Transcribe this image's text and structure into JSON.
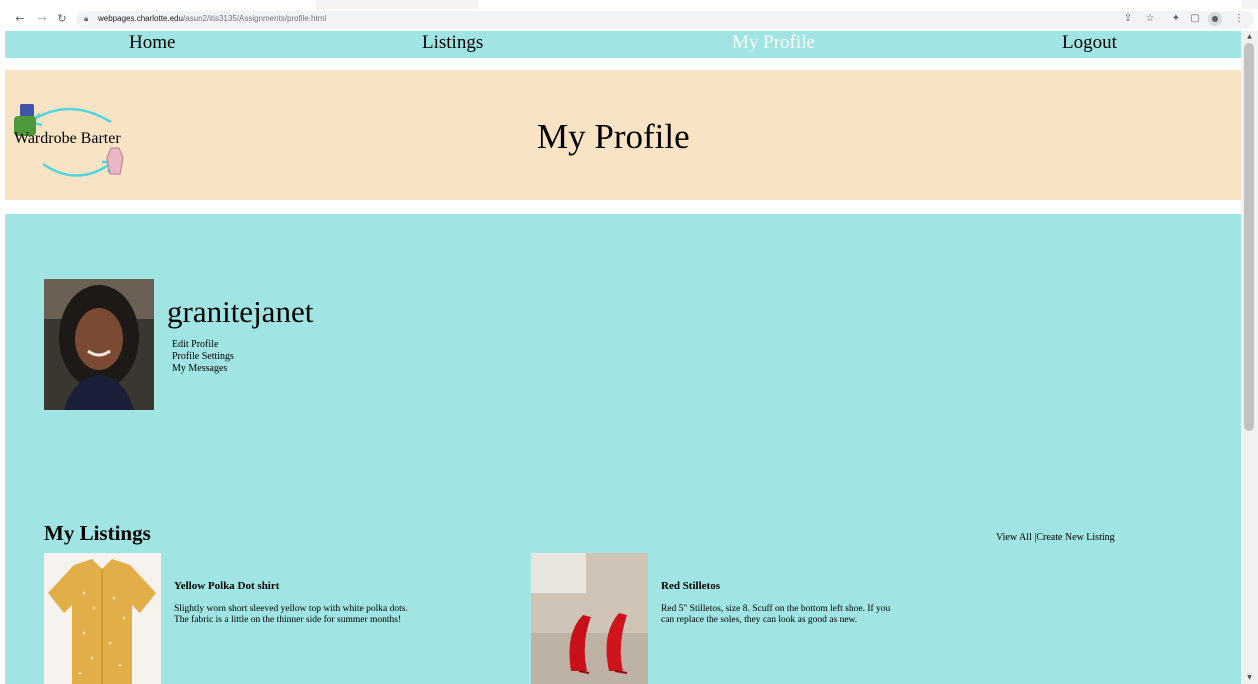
{
  "browser": {
    "url_host": "webpages.charlotte.edu",
    "url_path": "/asun2/itis3135/Assignments/profile.html",
    "icons": [
      "back-icon",
      "forward-icon",
      "reload-icon",
      "lock-icon",
      "share-icon",
      "star-icon",
      "extensions-icon",
      "sidepanel-icon",
      "profile-icon",
      "menu-icon"
    ]
  },
  "nav": {
    "items": [
      "Home",
      "Listings",
      "My Profile",
      "Logout"
    ],
    "active": "My Profile"
  },
  "banner": {
    "logo_text": "Wardrobe Barter",
    "title": "My Profile"
  },
  "profile": {
    "username": "granitejanet",
    "links": [
      "Edit Profile",
      "Profile Settings",
      "My Messages"
    ]
  },
  "listings": {
    "heading": "My Listings",
    "view_all": "View All",
    "separator": " |",
    "create_new": "Create New Listing",
    "items": [
      {
        "title": "Yellow Polka Dot shirt",
        "description": "Slightly worn short sleeved yellow top with white polka dots. The fabric is a little on the thinner side for summer months!"
      },
      {
        "title": "Red Stilletos",
        "description": "Red 5\" Stilletos, size 8. Scuff on the bottom left shoe. If you can replace the soles, they can look as good as new."
      }
    ]
  },
  "colors": {
    "teal": "#a0e4e3",
    "banner": "#f8e4c5",
    "active_nav": "#ffffff"
  }
}
